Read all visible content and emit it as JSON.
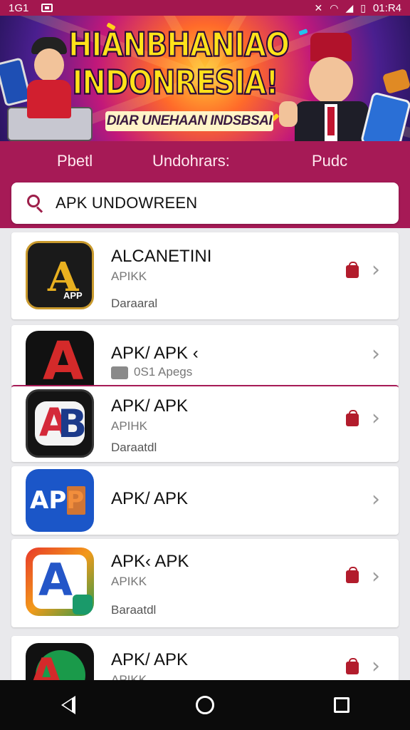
{
  "status_bar": {
    "left_text": "1⁠G1",
    "right_text": "01:R4",
    "icons": [
      "notification-icon",
      "mute-icon",
      "wifi-icon",
      "signal-icon",
      "battery-icon"
    ]
  },
  "banner": {
    "title_line1": "HIANBHANIAO",
    "title_line2": "INDONRESIA!",
    "subtitle": "DIAR UNEHAAN INDSBSAI"
  },
  "tabs": [
    "Pbetl",
    "Undohrars:",
    "Pudc"
  ],
  "search": {
    "value": "APK   UNDOWREEN"
  },
  "apps": [
    {
      "title": "ALCANETINI",
      "sub": "APIKK",
      "status": "Daraaral",
      "icon": "gold-a-logo-icon",
      "icon_label": "APP"
    },
    {
      "title": "APK/ APK ‹",
      "sub": "0S1 Apegs",
      "status": "",
      "icon": "red-a-logo-icon",
      "icon_label": ""
    },
    {
      "title": "APK/ APK",
      "sub": "APIHK",
      "status": "Daraatdl",
      "icon": "ab-logo-icon",
      "icon_label": "B"
    },
    {
      "title": "APK/ APK",
      "sub": "",
      "status": "",
      "icon": "app-blue-logo-icon",
      "icon_label": "APP"
    },
    {
      "title": "APK‹ APK",
      "sub": "APIKK",
      "status": "Baraatdl",
      "icon": "colorful-a-logo-icon",
      "icon_label": ""
    },
    {
      "title": "APK/ APK",
      "sub": "APIKK",
      "status": "",
      "icon": "green-arrow-logo-icon",
      "icon_label": ""
    }
  ],
  "colors": {
    "brand": "#a61a56",
    "status_bar": "#a3174f",
    "accent_bag": "#b21c2c",
    "nav_bar": "#0b0b0b"
  }
}
